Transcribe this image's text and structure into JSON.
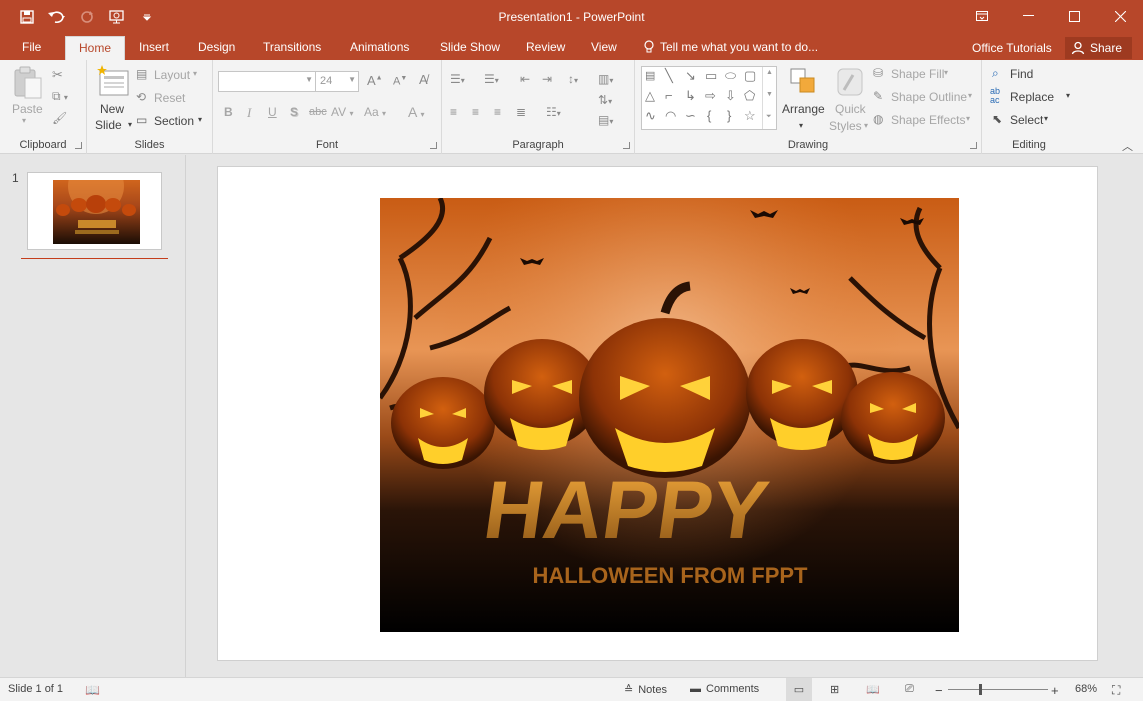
{
  "window": {
    "title": "Presentation1 - PowerPoint",
    "controls": [
      "ribbon-display-options",
      "minimize",
      "maximize",
      "close"
    ]
  },
  "colors": {
    "accent": "#b7472a",
    "ribbon_bg": "#f3f3f3",
    "workspace_bg": "#e6e6e6"
  },
  "tabs": [
    {
      "label": "File"
    },
    {
      "label": "Home"
    },
    {
      "label": "Insert"
    },
    {
      "label": "Design"
    },
    {
      "label": "Transitions"
    },
    {
      "label": "Animations"
    },
    {
      "label": "Slide Show"
    },
    {
      "label": "Review"
    },
    {
      "label": "View"
    }
  ],
  "active_tab": "Home",
  "tell_me": "Tell me what you want to do...",
  "office_tutorials": "Office Tutorials",
  "share": "Share",
  "ribbon": {
    "clipboard": {
      "paste": "Paste",
      "label": "Clipboard"
    },
    "slides": {
      "new_slide_line1": "New",
      "new_slide_line2": "Slide",
      "layout": "Layout",
      "reset": "Reset",
      "section": "Section",
      "label": "Slides"
    },
    "font": {
      "font_name": "",
      "font_size": "24",
      "bold": "B",
      "italic": "I",
      "underline": "U",
      "shadow": "S",
      "strike": "abc",
      "spacing": "AV",
      "case": "Aa",
      "color": "A",
      "label": "Font"
    },
    "paragraph": {
      "label": "Paragraph"
    },
    "drawing": {
      "arrange": "Arrange",
      "quick_styles_line1": "Quick",
      "quick_styles_line2": "Styles",
      "shape_fill": "Shape Fill",
      "shape_outline": "Shape Outline",
      "shape_effects": "Shape Effects",
      "label": "Drawing"
    },
    "editing": {
      "find": "Find",
      "replace": "Replace",
      "select": "Select",
      "label": "Editing"
    }
  },
  "thumbnails": [
    {
      "number": "1"
    }
  ],
  "slide": {
    "image": {
      "word_big": "HAPPY",
      "word_small": "HALLOWEEN FROM FPPT"
    }
  },
  "status": {
    "slide_info": "Slide 1 of 1",
    "notes": "Notes",
    "comments": "Comments",
    "zoom": "68%"
  }
}
